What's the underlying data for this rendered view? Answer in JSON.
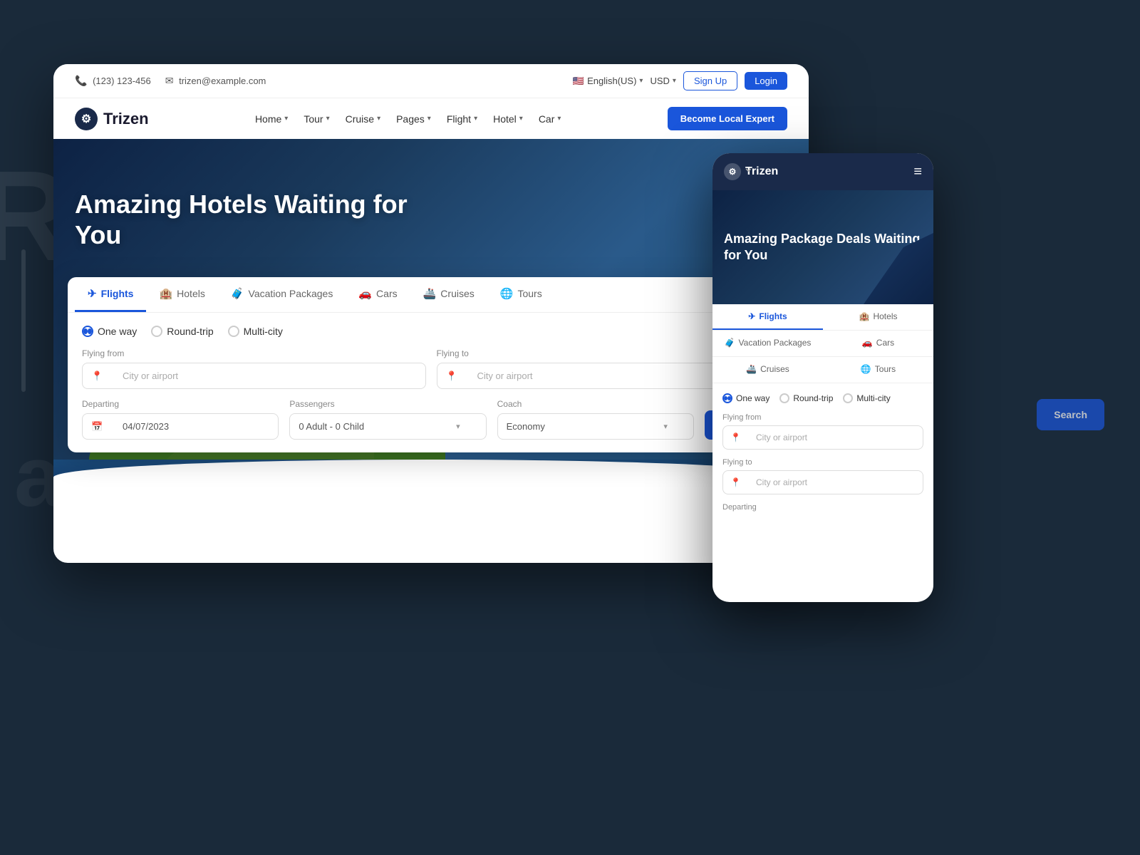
{
  "background": {
    "color": "#1a2a3a",
    "side_text": "Ro"
  },
  "desktop": {
    "topbar": {
      "phone": "(123) 123-456",
      "email": "trizen@example.com",
      "language": "English(US)",
      "currency": "USD",
      "signup_label": "Sign Up",
      "login_label": "Login"
    },
    "nav": {
      "logo_text": "Trizen",
      "links": [
        "Home",
        "Tour",
        "Cruise",
        "Pages",
        "Flight",
        "Hotel",
        "Car"
      ],
      "expert_btn": "Become Local Expert"
    },
    "hero": {
      "title": "Amazing Hotels Waiting for You"
    },
    "search": {
      "tabs": [
        {
          "label": "Flights",
          "icon": "✈",
          "active": true
        },
        {
          "label": "Hotels",
          "icon": "🏨"
        },
        {
          "label": "Vacation Packages",
          "icon": "🧳"
        },
        {
          "label": "Cars",
          "icon": "🚗"
        },
        {
          "label": "Cruises",
          "icon": "🚢"
        },
        {
          "label": "Tours",
          "icon": "🌐"
        }
      ],
      "trip_types": [
        "One way",
        "Round-trip",
        "Multi-city"
      ],
      "active_trip": "One way",
      "flying_from_label": "Flying from",
      "flying_from_placeholder": "City or airport",
      "flying_to_label": "Flying to",
      "flying_to_placeholder": "City or airport",
      "departing_label": "Departing",
      "departing_value": "04/07/2023",
      "passengers_label": "Passengers",
      "passengers_value": "0 Adult - 0 Child",
      "coach_label": "Coach",
      "coach_value": "Economy",
      "search_btn": "Search"
    }
  },
  "mobile": {
    "logo_text": "Trizen",
    "hero_title": "Amazing Package Deals Waiting for You",
    "tabs_row1": [
      {
        "label": "Flights",
        "icon": "✈",
        "active": true
      },
      {
        "label": "Hotels",
        "icon": "🏨"
      }
    ],
    "tabs_row2": [
      {
        "label": "Vacation Packages",
        "icon": "🧳"
      },
      {
        "label": "Cars",
        "icon": "🚗"
      }
    ],
    "tabs_row3": [
      {
        "label": "Cruises",
        "icon": "🚢"
      },
      {
        "label": "Tours",
        "icon": "🌐"
      }
    ],
    "trip_types": [
      "One way",
      "Round-trip",
      "Multi-city"
    ],
    "active_trip": "One way",
    "flying_from_label": "Flying from",
    "flying_from_placeholder": "City or airport",
    "flying_to_label": "Flying to",
    "flying_to_placeholder": "City or airport",
    "departing_label": "Departing"
  }
}
